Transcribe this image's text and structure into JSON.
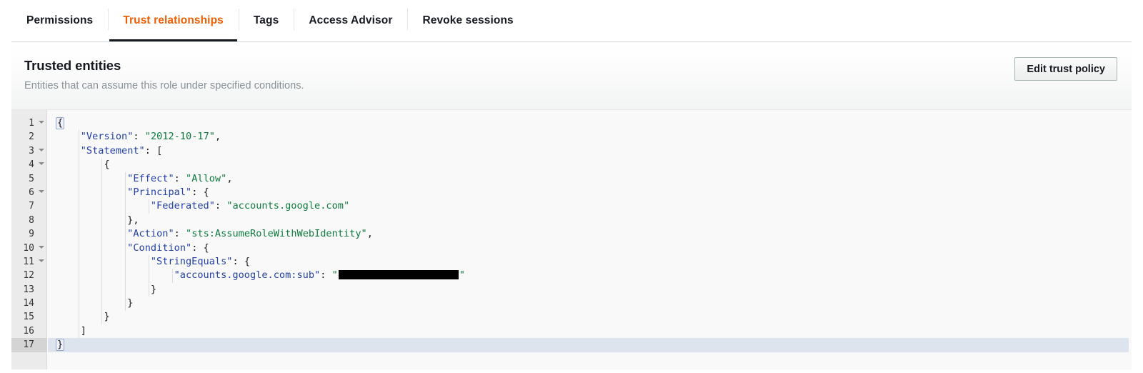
{
  "tabs": [
    {
      "label": "Permissions",
      "active": false
    },
    {
      "label": "Trust relationships",
      "active": true
    },
    {
      "label": "Tags",
      "active": false
    },
    {
      "label": "Access Advisor",
      "active": false
    },
    {
      "label": "Revoke sessions",
      "active": false
    }
  ],
  "panel": {
    "title": "Trusted entities",
    "subtitle": "Entities that can assume this role under specified conditions.",
    "edit_button_label": "Edit trust policy"
  },
  "colors": {
    "active_tab_text": "#eb5f07",
    "active_tab_underline": "#16191f",
    "json_key": "#2240a8",
    "json_string": "#0c7a3e",
    "gutter_bg": "#ebebeb",
    "editor_bg": "#f9f9f9",
    "active_line_bg": "#dde4ee",
    "redaction": "#000000"
  },
  "editor": {
    "language": "json",
    "active_line": 17,
    "total_lines": 17,
    "foldable_lines": [
      1,
      3,
      4,
      6,
      10,
      11
    ],
    "line_numbers": [
      "1",
      "2",
      "3",
      "4",
      "5",
      "6",
      "7",
      "8",
      "9",
      "10",
      "11",
      "12",
      "13",
      "14",
      "15",
      "16",
      "17"
    ],
    "policy_text": "{\n    \"Version\": \"2012-10-17\",\n    \"Statement\": [\n        {\n            \"Effect\": \"Allow\",\n            \"Principal\": {\n                \"Federated\": \"accounts.google.com\"\n            },\n            \"Action\": \"sts:AssumeRoleWithWebIdentity\",\n            \"Condition\": {\n                \"StringEquals\": {\n                    \"accounts.google.com:sub\": \"[REDACTED]\"\n                }\n            }\n        }\n    ]\n}",
    "lines": [
      {
        "n": "1",
        "indent": 0,
        "tokens": [
          {
            "t": "{",
            "c": "p",
            "brace": true
          }
        ]
      },
      {
        "n": "2",
        "indent": 1,
        "tokens": [
          {
            "t": "\"Version\"",
            "c": "k"
          },
          {
            "t": ": ",
            "c": "p"
          },
          {
            "t": "\"2012-10-17\"",
            "c": "s"
          },
          {
            "t": ",",
            "c": "p"
          }
        ]
      },
      {
        "n": "3",
        "indent": 1,
        "tokens": [
          {
            "t": "\"Statement\"",
            "c": "k"
          },
          {
            "t": ": [",
            "c": "p"
          }
        ]
      },
      {
        "n": "4",
        "indent": 2,
        "tokens": [
          {
            "t": "{",
            "c": "p"
          }
        ]
      },
      {
        "n": "5",
        "indent": 3,
        "tokens": [
          {
            "t": "\"Effect\"",
            "c": "k"
          },
          {
            "t": ": ",
            "c": "p"
          },
          {
            "t": "\"Allow\"",
            "c": "s"
          },
          {
            "t": ",",
            "c": "p"
          }
        ]
      },
      {
        "n": "6",
        "indent": 3,
        "tokens": [
          {
            "t": "\"Principal\"",
            "c": "k"
          },
          {
            "t": ": {",
            "c": "p"
          }
        ]
      },
      {
        "n": "7",
        "indent": 4,
        "tokens": [
          {
            "t": "\"Federated\"",
            "c": "k"
          },
          {
            "t": ": ",
            "c": "p"
          },
          {
            "t": "\"accounts.google.com\"",
            "c": "s"
          }
        ]
      },
      {
        "n": "8",
        "indent": 3,
        "tokens": [
          {
            "t": "},",
            "c": "p"
          }
        ]
      },
      {
        "n": "9",
        "indent": 3,
        "tokens": [
          {
            "t": "\"Action\"",
            "c": "k"
          },
          {
            "t": ": ",
            "c": "p"
          },
          {
            "t": "\"sts:AssumeRoleWithWebIdentity\"",
            "c": "s"
          },
          {
            "t": ",",
            "c": "p"
          }
        ]
      },
      {
        "n": "10",
        "indent": 3,
        "tokens": [
          {
            "t": "\"Condition\"",
            "c": "k"
          },
          {
            "t": ": {",
            "c": "p"
          }
        ]
      },
      {
        "n": "11",
        "indent": 4,
        "tokens": [
          {
            "t": "\"StringEquals\"",
            "c": "k"
          },
          {
            "t": ": {",
            "c": "p"
          }
        ]
      },
      {
        "n": "12",
        "indent": 5,
        "tokens": [
          {
            "t": "\"accounts.google.com:sub\"",
            "c": "k"
          },
          {
            "t": ": ",
            "c": "p"
          },
          {
            "t": "\"",
            "c": "s"
          },
          {
            "t": "",
            "c": "s",
            "redacted": true
          },
          {
            "t": "\"",
            "c": "s"
          }
        ]
      },
      {
        "n": "13",
        "indent": 4,
        "tokens": [
          {
            "t": "}",
            "c": "p"
          }
        ]
      },
      {
        "n": "14",
        "indent": 3,
        "tokens": [
          {
            "t": "}",
            "c": "p"
          }
        ]
      },
      {
        "n": "15",
        "indent": 2,
        "tokens": [
          {
            "t": "}",
            "c": "p"
          }
        ]
      },
      {
        "n": "16",
        "indent": 1,
        "tokens": [
          {
            "t": "]",
            "c": "p"
          }
        ]
      },
      {
        "n": "17",
        "indent": 0,
        "tokens": [
          {
            "t": "}",
            "c": "p",
            "brace": true
          }
        ],
        "active": true
      }
    ]
  }
}
